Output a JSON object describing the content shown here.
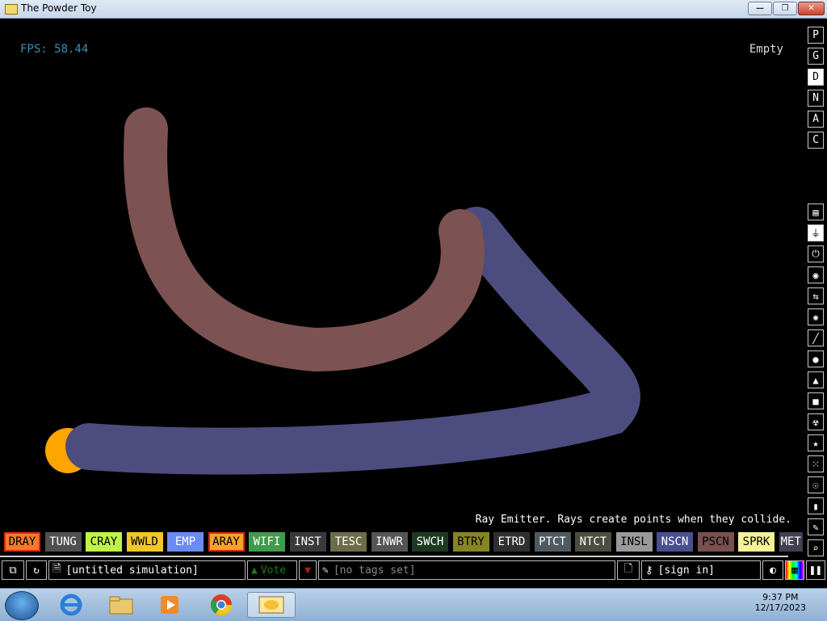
{
  "window": {
    "title": "The Powder Toy",
    "minimize": "—",
    "maximize": "❐",
    "close": "✕"
  },
  "hud": {
    "fps": "FPS: 58.44",
    "hover": "Empty",
    "description": "Ray Emitter. Rays create points when they collide."
  },
  "side_buttons": [
    {
      "label": "P",
      "name": "pause-sim-button",
      "active": false
    },
    {
      "label": "G",
      "name": "gravity-button",
      "active": false
    },
    {
      "label": "D",
      "name": "decorations-button",
      "active": true
    },
    {
      "label": "N",
      "name": "newtonian-button",
      "active": false
    },
    {
      "label": "A",
      "name": "ambient-heat-button",
      "active": false
    },
    {
      "label": "C",
      "name": "console-button",
      "active": false
    }
  ],
  "categories": [
    {
      "name": "walls-category-icon",
      "glyph": "▤"
    },
    {
      "name": "electronics-category-icon",
      "glyph": "⏚"
    },
    {
      "name": "powered-category-icon",
      "glyph": "⏻"
    },
    {
      "name": "sensors-category-icon",
      "glyph": "◉"
    },
    {
      "name": "force-category-icon",
      "glyph": "⇆"
    },
    {
      "name": "explosives-category-icon",
      "glyph": "✺"
    },
    {
      "name": "gases-category-icon",
      "glyph": "╱"
    },
    {
      "name": "liquids-category-icon",
      "glyph": "●"
    },
    {
      "name": "powders-category-icon",
      "glyph": "▲"
    },
    {
      "name": "solids-category-icon",
      "glyph": "■"
    },
    {
      "name": "radioactive-category-icon",
      "glyph": "☢"
    },
    {
      "name": "special-category-icon",
      "glyph": "★"
    },
    {
      "name": "life-category-icon",
      "glyph": "⁙"
    },
    {
      "name": "tools-category-icon",
      "glyph": "☉"
    },
    {
      "name": "favorites-category-icon",
      "glyph": "▮"
    },
    {
      "name": "deco-category-icon",
      "glyph": "✎"
    },
    {
      "name": "search-category-icon",
      "glyph": "⌕"
    }
  ],
  "elements": [
    {
      "label": "DRAY",
      "bg": "#f77a2a",
      "fg": "#000",
      "sel": true
    },
    {
      "label": "TUNG",
      "bg": "#505050",
      "fg": "#fff",
      "sel": false
    },
    {
      "label": "CRAY",
      "bg": "#bff34a",
      "fg": "#000",
      "sel": false
    },
    {
      "label": "WWLD",
      "bg": "#f3c726",
      "fg": "#000",
      "sel": false
    },
    {
      "label": "EMP",
      "bg": "#6a8bf2",
      "fg": "#fff",
      "sel": false
    },
    {
      "label": "ARAY",
      "bg": "#f0a42c",
      "fg": "#000",
      "sel": true
    },
    {
      "label": "WIFI",
      "bg": "#3e9c4a",
      "fg": "#fff",
      "sel": false
    },
    {
      "label": "INST",
      "bg": "#3a3a3a",
      "fg": "#fff",
      "sel": false
    },
    {
      "label": "TESC",
      "bg": "#6c6c4a",
      "fg": "#fff",
      "sel": false
    },
    {
      "label": "INWR",
      "bg": "#555555",
      "fg": "#fff",
      "sel": false
    },
    {
      "label": "SWCH",
      "bg": "#1e3a22",
      "fg": "#fff",
      "sel": false
    },
    {
      "label": "BTRY",
      "bg": "#878423",
      "fg": "#000",
      "sel": false
    },
    {
      "label": "ETRD",
      "bg": "#303030",
      "fg": "#fff",
      "sel": false
    },
    {
      "label": "PTCT",
      "bg": "#4f5a60",
      "fg": "#fff",
      "sel": false
    },
    {
      "label": "NTCT",
      "bg": "#4d4d40",
      "fg": "#fff",
      "sel": false
    },
    {
      "label": "INSL",
      "bg": "#9a9a9a",
      "fg": "#000",
      "sel": false
    },
    {
      "label": "NSCN",
      "bg": "#4a4f8f",
      "fg": "#fff",
      "sel": false
    },
    {
      "label": "PSCN",
      "bg": "#7a4f4f",
      "fg": "#000",
      "sel": false
    },
    {
      "label": "SPRK",
      "bg": "#f5f296",
      "fg": "#000",
      "sel": false
    },
    {
      "label": "MET",
      "bg": "#404050",
      "fg": "#fff",
      "sel": false
    }
  ],
  "bottom_bar": {
    "open_icon": "⧉",
    "reload_icon": "↻",
    "save_icon": "🗎",
    "save_name": "[untitled simulation]",
    "vote_up_icon": "▲",
    "vote_label": "Vote",
    "vote_down_icon": "▼",
    "tag_icon": "✎",
    "tags": "[no tags set]",
    "new_icon": "🗋",
    "login_icon": "⚷",
    "login": "[sign in]",
    "settings_icon": "◐",
    "render_icon": "▦",
    "pause_icon": "❚❚"
  },
  "taskbar": {
    "time": "9:37 PM",
    "date": "12/17/2023"
  },
  "colors": {
    "pscn": "#7d5252",
    "nscn": "#4c4c7e",
    "aray": "#ffa500"
  }
}
